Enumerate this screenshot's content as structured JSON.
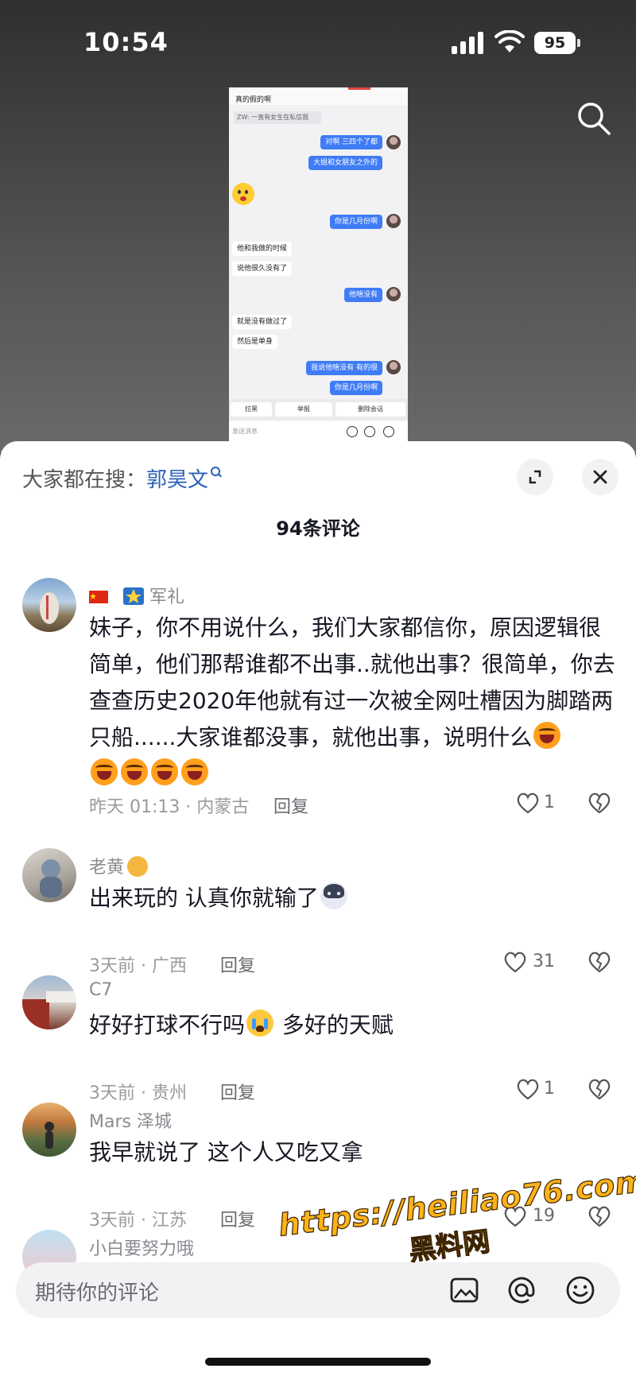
{
  "status_bar": {
    "time": "10:54",
    "battery": "95"
  },
  "chat_screenshot": {
    "top_line": "真的假的啊",
    "quote": "ZW: 一直有女生在私信我",
    "messages": [
      {
        "from": "me",
        "text": "对啊 三四个了都"
      },
      {
        "from": "me",
        "text": "大姐和女朋友之外的"
      },
      {
        "from": "me",
        "text": "你是几月份啊"
      },
      {
        "from": "them",
        "text": "他和我做的时候"
      },
      {
        "from": "them",
        "text": "说他很久没有了"
      },
      {
        "from": "me",
        "text": "他啥没有"
      },
      {
        "from": "them",
        "text": "就是没有做过了"
      },
      {
        "from": "them",
        "text": "然后是单身"
      },
      {
        "from": "me",
        "text": "我说他啥没有 有的很"
      },
      {
        "from": "me",
        "text": "你是几月份啊"
      }
    ],
    "actions": [
      "拉黑",
      "举报",
      "删除会话"
    ],
    "input_placeholder": "发送消息"
  },
  "sheet": {
    "hot_search_label": "大家都在搜：",
    "hot_search_term": "郭昊文",
    "comment_count": "94条评论"
  },
  "comments": [
    {
      "username": "军礼",
      "text": "妹子，你不用说什么，我们大家都信你，原因逻辑很简单，他们那帮谁都不出事..就他出事？很简单，你去查查历史2020年他就有过一次被全网吐槽因为脚踏两只船......大家谁都没事，就他出事，说明什么",
      "time_location": "昨天 01:13 · 内蒙古",
      "reply": "回复",
      "likes": "1"
    },
    {
      "username": "老黄",
      "text": "出来玩的 认真你就输了",
      "time_location": "3天前 · 广西",
      "reply": "回复",
      "likes": "31"
    },
    {
      "username": "C7",
      "text_a": "好好打球不行吗",
      "text_b": "多好的天赋",
      "time_location": "3天前 · 贵州",
      "reply": "回复",
      "likes": "1"
    },
    {
      "username": "Mars 泽城",
      "text": "我早就说了 这个人又吃又拿",
      "time_location": "3天前 · 江苏",
      "reply": "回复",
      "likes": "19"
    },
    {
      "username": "小白要努力哦"
    }
  ],
  "input_bar": {
    "placeholder": "期待你的评论"
  },
  "watermark": {
    "url": "https://heiliao76.com",
    "name": "黑料网"
  },
  "colors": {
    "accent_link": "#2b5fb6",
    "chat_blue": "#3f7cf5",
    "watermark": "#ffb21a"
  }
}
